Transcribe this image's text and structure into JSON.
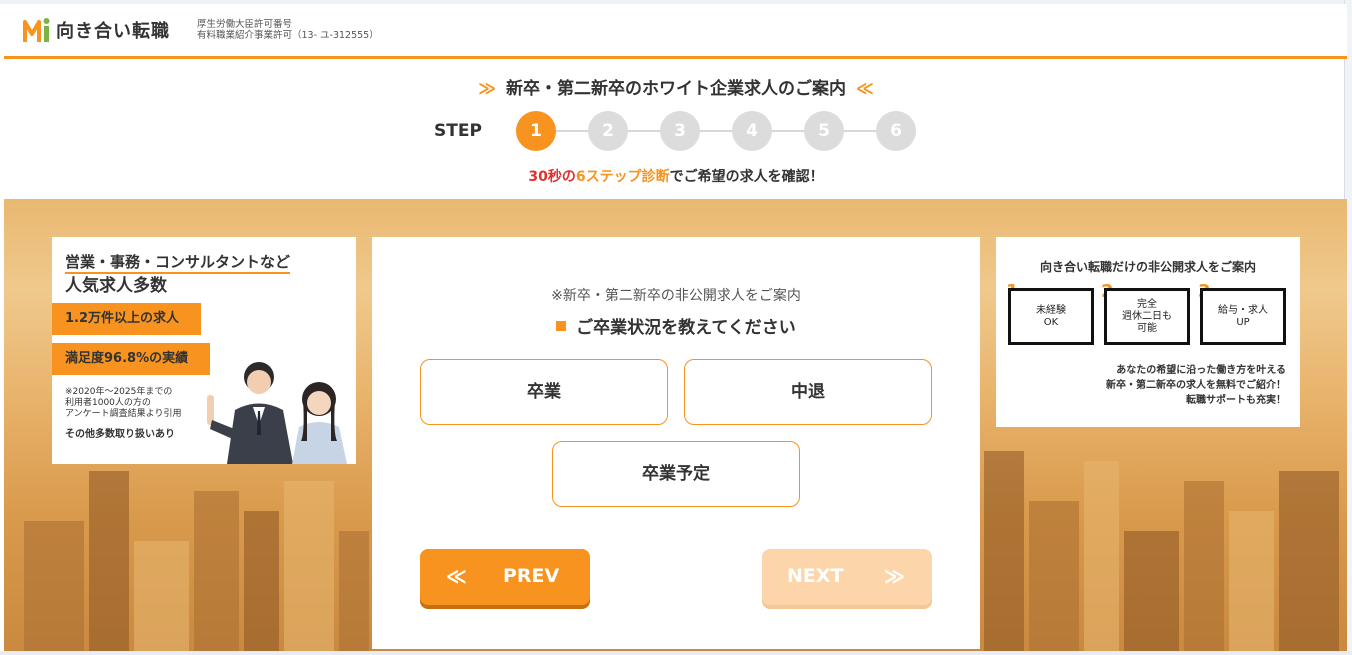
{
  "header": {
    "logo_text": "向き合い転職",
    "license_line1": "厚生労働大臣許可番号",
    "license_line2": "有料職業紹介事業許可（13- ユ-312555）"
  },
  "title": {
    "text": "新卒・第二新卒のホワイト企業求人のご案内",
    "left_chevron": "≫",
    "right_chevron": "≪"
  },
  "steps": {
    "label": "STEP",
    "items": [
      "1",
      "2",
      "3",
      "4",
      "5",
      "6"
    ],
    "active": 1
  },
  "diagnosis": {
    "part_red": "30秒の",
    "part_orange": "6ステップ診断",
    "part_rest": "でご希望の求人を確認！"
  },
  "left_card": {
    "title_line1": "営業・事務・コンサルタントなど",
    "title_line2": "人気求人多数",
    "badge1": "1.2万件以上の求人",
    "badge2": "満足度96.8%の実績",
    "note_line1": "※2020年～2025年までの",
    "note_line2": "利用者1000人の方の",
    "note_line3": "アンケート調査結果より引用",
    "more": "その他多数取り扱いあり"
  },
  "question": {
    "subtext": "※新卒・第二新卒の非公開求人をご案内",
    "text": "ご卒業状況を教えてください",
    "options": [
      "卒業",
      "中退",
      "卒業予定"
    ]
  },
  "nav": {
    "prev_label": "PREV",
    "prev_icon": "≪",
    "next_label": "NEXT",
    "next_icon": "≫"
  },
  "right_card": {
    "title": "向き合い転職だけの非公開求人をご案内",
    "features": [
      {
        "num": "1",
        "text": "未経験\nOK"
      },
      {
        "num": "2",
        "text": "完全\n週休二日も\n可能"
      },
      {
        "num": "3",
        "text": "給与・求人\nUP"
      }
    ],
    "desc_line1": "あなたの希望に沿った働き方を叶える",
    "desc_line2": "新卒・第二新卒の求人を無料でご紹介！",
    "desc_line3": "転職サポートも充実！"
  },
  "colors": {
    "accent": "#f7931e",
    "highlight_red": "#e03131",
    "step_inactive": "#dcdcdc",
    "next_disabled": "#fcd6aa"
  }
}
